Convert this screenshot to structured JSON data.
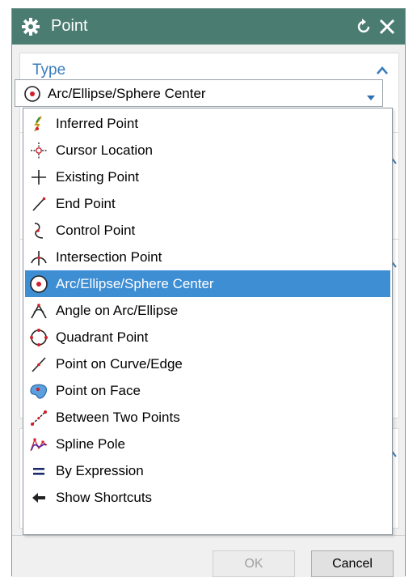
{
  "dialog": {
    "title": "Point"
  },
  "type_section": {
    "title": "Type",
    "selected_value": "Arc/Ellipse/Sphere Center"
  },
  "dropdown": {
    "items": [
      {
        "label": "Inferred Point",
        "icon": "inferred-point-icon"
      },
      {
        "label": "Cursor Location",
        "icon": "cursor-location-icon"
      },
      {
        "label": "Existing Point",
        "icon": "existing-point-icon"
      },
      {
        "label": "End Point",
        "icon": "end-point-icon"
      },
      {
        "label": "Control Point",
        "icon": "control-point-icon"
      },
      {
        "label": "Intersection Point",
        "icon": "intersection-point-icon"
      },
      {
        "label": "Arc/Ellipse/Sphere Center",
        "icon": "arc-center-icon",
        "selected": true
      },
      {
        "label": "Angle on Arc/Ellipse",
        "icon": "angle-on-arc-icon"
      },
      {
        "label": "Quadrant Point",
        "icon": "quadrant-point-icon"
      },
      {
        "label": "Point on Curve/Edge",
        "icon": "point-on-curve-icon"
      },
      {
        "label": "Point on Face",
        "icon": "point-on-face-icon"
      },
      {
        "label": "Between Two Points",
        "icon": "between-two-points-icon"
      },
      {
        "label": "Spline Pole",
        "icon": "spline-pole-icon"
      },
      {
        "label": "By Expression",
        "icon": "by-expression-icon"
      },
      {
        "label": "Show Shortcuts",
        "icon": "show-shortcuts-icon"
      }
    ]
  },
  "footer": {
    "ok_label": "OK",
    "cancel_label": "Cancel"
  },
  "colors": {
    "titlebar": "#4a7c71",
    "accent": "#3a7dbd",
    "selection": "#3e8ed4"
  }
}
